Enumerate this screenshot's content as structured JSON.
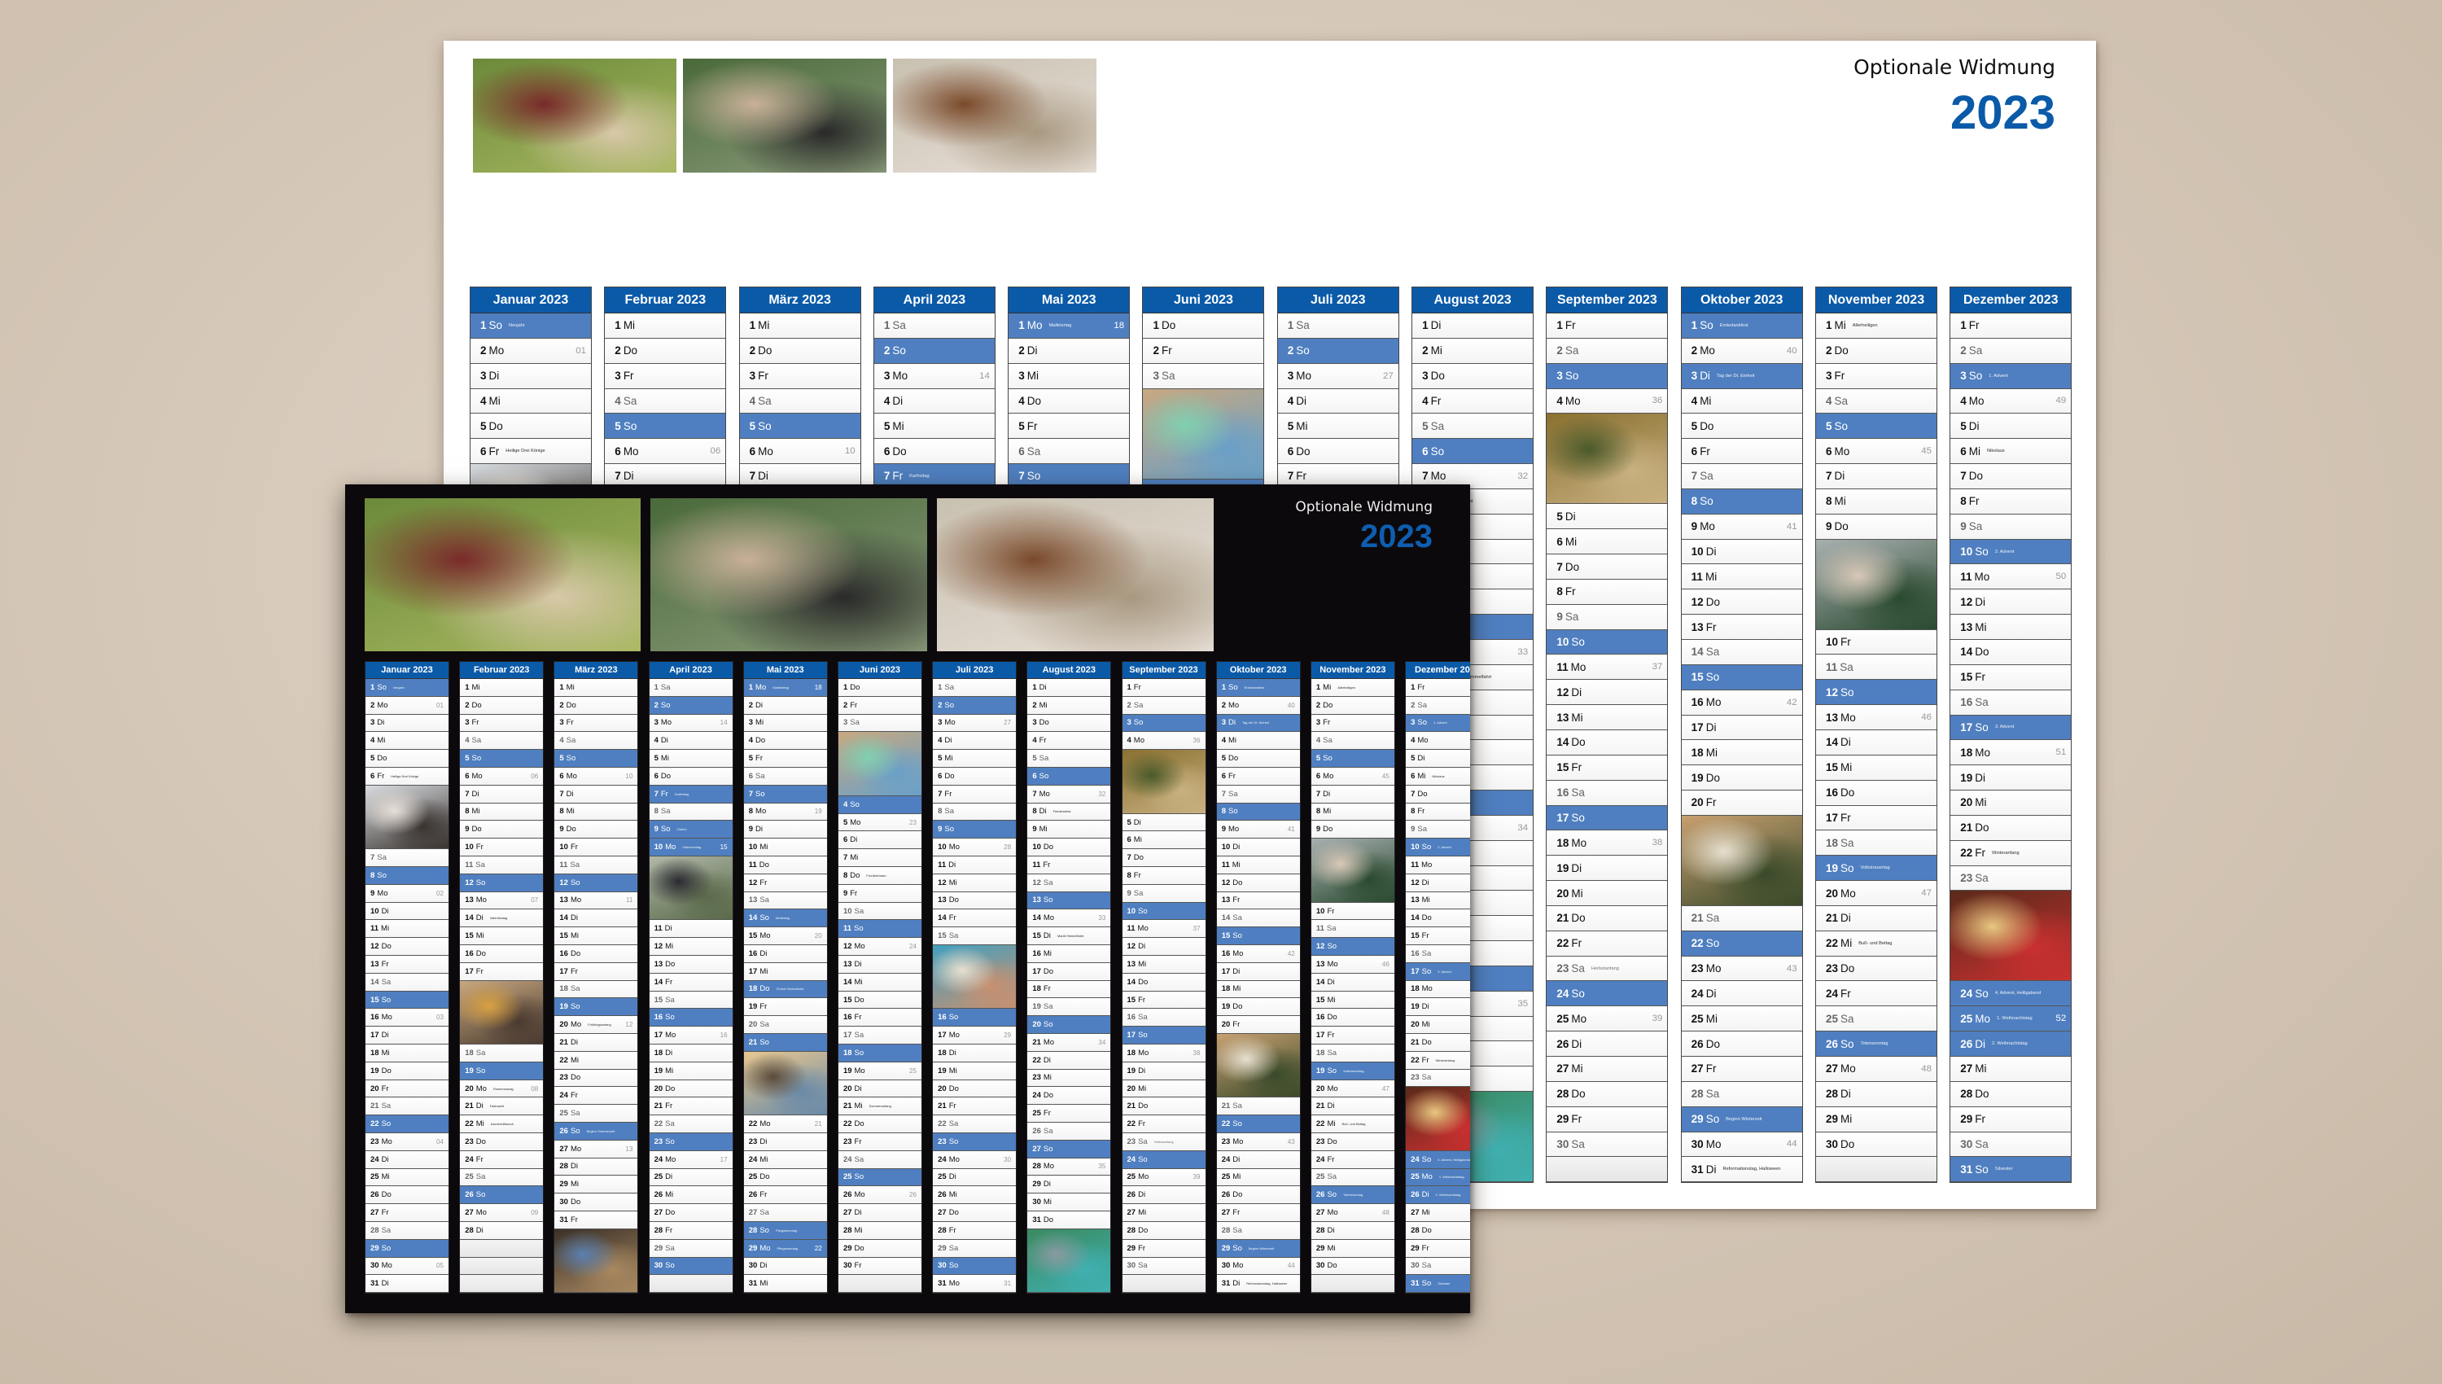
{
  "colors": {
    "header_blue": "#0b5aa8",
    "sunday_blue": "#4f7fc0",
    "light_poster_bg": "#ffffff",
    "dark_poster_bg": "#0c090c",
    "wall": "#d4c6b6"
  },
  "dedication": "Optionale Widmung",
  "year": "2023",
  "weekdays": [
    "So",
    "Mo",
    "Di",
    "Mi",
    "Do",
    "Fr",
    "Sa"
  ],
  "top_photos": [
    {
      "name": "mother-baby-photo",
      "desc": "Mother lifting baby in superhero costume under trees",
      "colors": [
        "#6b8a3a",
        "#a8b860",
        "#7a2a2a",
        "#d8c8a8"
      ]
    },
    {
      "name": "couple-waterfall-photo",
      "desc": "Couple forehead-to-forehead in front of waterfall",
      "colors": [
        "#4a6a3a",
        "#8a9a7a",
        "#c8b098",
        "#2a2a2a"
      ]
    },
    {
      "name": "dog-beach-photo",
      "desc": "Brown-and-white dog on beach",
      "colors": [
        "#c8c0b0",
        "#e8e0d8",
        "#7a4a2a",
        "#a89880"
      ]
    }
  ],
  "months": [
    {
      "name": "Januar 2023",
      "days": 31,
      "start": 0,
      "holidays": {
        "1": "Neujahr",
        "6": "Heilige Drei Könige"
      },
      "photo_after": 6,
      "photo_desc": "Woman in white knit hat in winter",
      "photo_colors": [
        "#d8dce0",
        "#3a3430",
        "#e8e0d8"
      ]
    },
    {
      "name": "Februar 2023",
      "days": 28,
      "start": 3,
      "holidays": {
        "14": "Valentinstag",
        "20": "Rosenmontag",
        "21": "Fastnacht",
        "22": "Aschermittwoch"
      },
      "photo_after": 17,
      "photo_desc": "Couple in scarves smiling",
      "photo_colors": [
        "#c8a880",
        "#4a3a30",
        "#d8a040"
      ]
    },
    {
      "name": "März 2023",
      "days": 31,
      "start": 3,
      "holidays": {
        "20": "Frühlingsanfang",
        "26": "Beginn Sommerzeit"
      },
      "photo_after": 31,
      "photo_desc": "Couple laughing in cafe",
      "photo_colors": [
        "#3a3028",
        "#a88860",
        "#5a80b0"
      ]
    },
    {
      "name": "April 2023",
      "days": 30,
      "start": 6,
      "holidays": {
        "7": "Karfreitag",
        "9": "Ostern",
        "10": "Ostermontag"
      },
      "photo_after": 10,
      "photo_desc": "Couple kissing in field",
      "photo_colors": [
        "#b0b8a8",
        "#5a6a4a",
        "#2a2a30"
      ]
    },
    {
      "name": "Mai 2023",
      "days": 31,
      "start": 1,
      "holidays": {
        "1": "Maifeiertag",
        "14": "Muttertag",
        "18": "Christi Himmelfahrt",
        "28": "Pfingstsonntag",
        "29": "Pfingstmontag"
      },
      "photo_after": 21,
      "photo_desc": "Children lying in grass at sunset",
      "photo_colors": [
        "#e8c890",
        "#6a8aa8",
        "#5a4a3a"
      ]
    },
    {
      "name": "Juni 2023",
      "days": 30,
      "start": 4,
      "holidays": {
        "8": "Fronleichnam",
        "21": "Sommeranfang"
      },
      "photo_after": 3,
      "photo_desc": "Two children hugging on beach",
      "photo_colors": [
        "#c8a880",
        "#6aa0c8",
        "#80d0b0"
      ]
    },
    {
      "name": "Juli 2023",
      "days": 31,
      "start": 6,
      "holidays": {},
      "photo_after": 15,
      "photo_desc": "Couple piggyback at sea",
      "photo_colors": [
        "#40a0c0",
        "#c89070",
        "#e8e0d0"
      ]
    },
    {
      "name": "August 2023",
      "days": 31,
      "start": 2,
      "holidays": {
        "8": "Friedensfest",
        "15": "Mariä Himmelfahrt"
      },
      "photo_after": 31,
      "photo_desc": "Couple on boat near limestone cliffs",
      "photo_colors": [
        "#3a8a60",
        "#40b0b0",
        "#8a9aa0"
      ]
    },
    {
      "name": "September 2023",
      "days": 30,
      "start": 5,
      "holidays": {
        "23": "Herbstanfang"
      },
      "photo_after": 4,
      "photo_desc": "Couple on wooden bridge in jungle",
      "photo_colors": [
        "#8a7030",
        "#c8b080",
        "#4a5a2a"
      ]
    },
    {
      "name": "Oktober 2023",
      "days": 31,
      "start": 0,
      "holidays": {
        "1": "Erntedankfest",
        "3": "Tag der Dt. Einheit",
        "29": "Beginn Winterzeit",
        "31": "Reformationstag, Halloween"
      },
      "photo_after": 20,
      "photo_desc": "Couple with dried flower bouquet",
      "photo_colors": [
        "#c8a070",
        "#3a4a2a",
        "#e8e0d0"
      ]
    },
    {
      "name": "November 2023",
      "days": 30,
      "start": 3,
      "holidays": {
        "1": "Allerheiligen",
        "19": "Volkstrauertag",
        "22": "Buß- und Bettag",
        "26": "Totensonntag"
      },
      "photo_after": 9,
      "photo_desc": "Elderly couple kissing at beach",
      "photo_colors": [
        "#a8b0b0",
        "#2a4a30",
        "#d8c8b8"
      ]
    },
    {
      "name": "Dezember 2023",
      "days": 31,
      "start": 5,
      "holidays": {
        "3": "1. Advent",
        "6": "Nikolaus",
        "10": "2. Advent",
        "17": "3. Advent",
        "22": "Winteranfang",
        "24": "4. Advent, Heiligabend",
        "25": "1. Weihnachtstag",
        "26": "2. Weihnachtstag",
        "31": "Silvester"
      },
      "photo_after": 23,
      "photo_desc": "Family with sparklers by Christmas tree",
      "photo_colors": [
        "#5a2a1a",
        "#c83030",
        "#e8c880"
      ]
    }
  ],
  "holiday_blue_days": {
    "1": [
      1
    ],
    "4": [
      7,
      10
    ],
    "5": [
      1,
      18,
      29
    ],
    "10": [
      3
    ],
    "12": [
      25,
      26
    ]
  }
}
